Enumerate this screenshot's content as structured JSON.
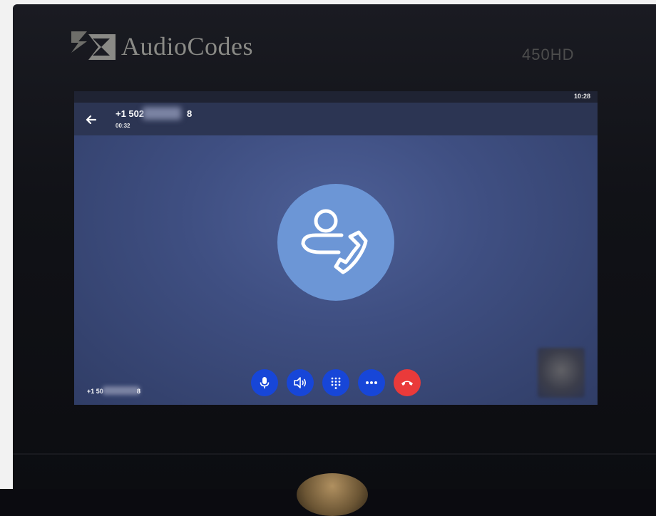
{
  "device": {
    "brand": "AudioCodes",
    "model": "450HD"
  },
  "status": {
    "time": "10:28"
  },
  "call": {
    "number_prefix": "+1 502",
    "number_suffix": "8",
    "duration": "00:32"
  },
  "footer": {
    "number_prefix": "+1 50",
    "number_suffix": "8"
  },
  "controls": [
    {
      "name": "mute",
      "icon": "microphone-icon"
    },
    {
      "name": "speaker",
      "icon": "speaker-icon"
    },
    {
      "name": "keypad",
      "icon": "dialpad-icon"
    },
    {
      "name": "more",
      "icon": "more-icon"
    },
    {
      "name": "end-call",
      "icon": "hangup-icon"
    }
  ],
  "colors": {
    "control_blue": "#1746d8",
    "end_call_red": "#ea3a3a",
    "avatar_circle": "#6c96d6"
  }
}
